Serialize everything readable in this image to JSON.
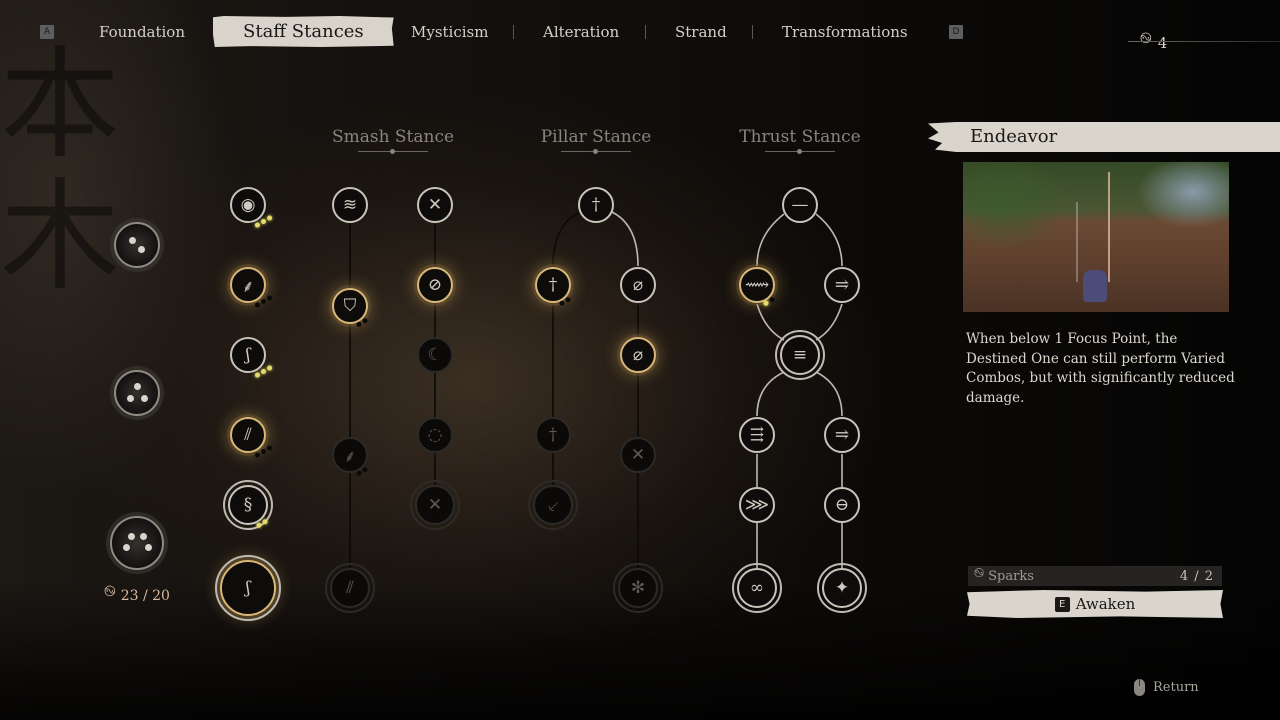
{
  "nav": {
    "left_key": "A",
    "right_key": "D",
    "tabs": [
      {
        "label": "Foundation",
        "active": false
      },
      {
        "label": "Staff Stances",
        "active": true
      },
      {
        "label": "Mysticism",
        "active": false
      },
      {
        "label": "Alteration",
        "active": false
      },
      {
        "label": "Strand",
        "active": false
      },
      {
        "label": "Transformations",
        "active": false
      }
    ],
    "sparks_icon": "spark-swirl-icon",
    "sparks_available": "4"
  },
  "background": {
    "calligraphy": "本\n木"
  },
  "stances": [
    {
      "title": "Smash Stance"
    },
    {
      "title": "Pillar Stance"
    },
    {
      "title": "Thrust Stance"
    }
  ],
  "relics": {
    "count_icon": "spark-swirl-icon",
    "count": "23 / 20",
    "items": [
      {
        "name": "relic-two-pips",
        "pips": 2
      },
      {
        "name": "relic-three-pips",
        "pips": 3
      },
      {
        "name": "relic-four-pips",
        "pips": 4
      }
    ]
  },
  "skills": {
    "column_left": [
      {
        "name": "skill-focus-drop",
        "glyph": "◉",
        "state": "unlocked",
        "points": [
          1,
          1,
          1
        ]
      },
      {
        "name": "skill-spiral-staff",
        "glyph": "⸙",
        "state": "selected",
        "points": [
          0,
          0,
          0
        ]
      },
      {
        "name": "skill-hook-strike",
        "glyph": "ʃ",
        "state": "unlocked",
        "points": [
          1,
          1,
          1
        ]
      },
      {
        "name": "skill-spin-staff",
        "glyph": "⫽",
        "state": "selected",
        "points": [
          0,
          0,
          0
        ]
      },
      {
        "name": "skill-dragon-coil",
        "glyph": "§",
        "state": "unlocked-ornate",
        "points": [
          1,
          1
        ]
      },
      {
        "name": "skill-endeavor",
        "glyph": "ʃ",
        "state": "current-ornate",
        "points": []
      }
    ],
    "smash": [
      {
        "name": "smash-skill-1",
        "glyph": "≋",
        "state": "unlocked"
      },
      {
        "name": "smash-skill-2",
        "glyph": "⛉",
        "state": "selected",
        "points": [
          0,
          0
        ]
      },
      {
        "name": "smash-skill-3",
        "glyph": "⸙",
        "state": "locked",
        "points": [
          0,
          0
        ]
      },
      {
        "name": "smash-skill-4",
        "glyph": "⫽",
        "state": "locked-ornate"
      },
      {
        "name": "smash-skill-5",
        "glyph": "✕",
        "state": "unlocked"
      },
      {
        "name": "smash-skill-6",
        "glyph": "⊘",
        "state": "selected"
      },
      {
        "name": "smash-skill-7",
        "glyph": "☾",
        "state": "locked"
      },
      {
        "name": "smash-skill-8",
        "glyph": "◌",
        "state": "locked"
      },
      {
        "name": "smash-skill-9",
        "glyph": "✕",
        "state": "locked-ornate"
      }
    ],
    "pillar": [
      {
        "name": "pillar-skill-1",
        "glyph": "†",
        "state": "unlocked"
      },
      {
        "name": "pillar-skill-2",
        "glyph": "†",
        "state": "selected",
        "points": [
          0,
          0
        ]
      },
      {
        "name": "pillar-skill-3",
        "glyph": "†",
        "state": "locked"
      },
      {
        "name": "pillar-skill-4",
        "glyph": "⸔",
        "state": "locked-ornate"
      },
      {
        "name": "pillar-skill-5",
        "glyph": "⌀",
        "state": "unlocked"
      },
      {
        "name": "pillar-skill-6",
        "glyph": "⌀",
        "state": "selected"
      },
      {
        "name": "pillar-skill-7",
        "glyph": "✕",
        "state": "locked"
      },
      {
        "name": "pillar-skill-8",
        "glyph": "✻",
        "state": "locked-ornate"
      }
    ],
    "thrust": [
      {
        "name": "thrust-skill-1",
        "glyph": "—",
        "state": "unlocked"
      },
      {
        "name": "thrust-skill-2",
        "glyph": "⟿",
        "state": "selected",
        "points": [
          1,
          0
        ]
      },
      {
        "name": "thrust-skill-3",
        "glyph": "⥤",
        "state": "unlocked"
      },
      {
        "name": "thrust-skill-4",
        "glyph": "≡",
        "state": "unlocked-ornate"
      },
      {
        "name": "thrust-skill-5",
        "glyph": "⇶",
        "state": "unlocked"
      },
      {
        "name": "thrust-skill-6",
        "glyph": "⥤",
        "state": "unlocked"
      },
      {
        "name": "thrust-skill-7",
        "glyph": "⋙",
        "state": "unlocked"
      },
      {
        "name": "thrust-skill-8",
        "glyph": "⊖",
        "state": "unlocked"
      },
      {
        "name": "thrust-skill-9",
        "glyph": "∞",
        "state": "unlocked-ornate"
      },
      {
        "name": "thrust-skill-10",
        "glyph": "✦",
        "state": "unlocked-ornate"
      }
    ]
  },
  "detail": {
    "title": "Endeavor",
    "preview_alt": "Gameplay preview of the Destined One with staff",
    "description": "When below 1 Focus Point, the Destined One can still perform Varied Combos, but with significantly reduced damage.",
    "sparks_label": "Sparks",
    "sparks_value": "4 / 2",
    "action_key": "E",
    "action_label": "Awaken"
  },
  "footer": {
    "return_label": "Return",
    "return_icon": "mouse-icon"
  }
}
